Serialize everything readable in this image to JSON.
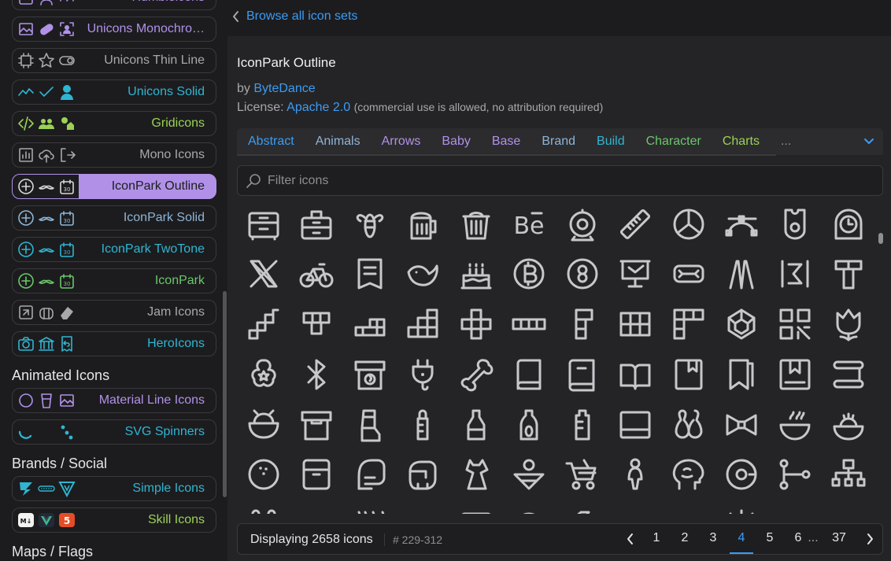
{
  "sidebar": {
    "sets": [
      {
        "label": "Humbleicons",
        "color": "#b191e8",
        "icons": [
          "archive-icon",
          "user-icon",
          "gauge-icon"
        ]
      },
      {
        "label": "Unicons Monochro…",
        "color": "#b191e8",
        "icons": [
          "image-icon",
          "pill-icon",
          "user-frame-icon"
        ]
      },
      {
        "label": "Unicons Thin Line",
        "color": "#a8a8ac",
        "icons": [
          "chip-icon",
          "star-icon",
          "toggle-icon"
        ]
      },
      {
        "label": "Unicons Solid",
        "color": "#2fb5d2",
        "icons": [
          "chart-line-icon",
          "check-icon",
          "user-solid-icon"
        ]
      },
      {
        "label": "Gridicons",
        "color": "#9bd156",
        "icons": [
          "code-icon",
          "users-icon",
          "shapes-icon"
        ]
      },
      {
        "label": "Mono Icons",
        "color": "#a8a8ac",
        "icons": [
          "bar-chart-icon",
          "cloud-upload-icon",
          "log-out-icon"
        ]
      },
      {
        "label": "IconPark Outline",
        "color": "#1c1c1e",
        "icons": [
          "add-circle-icon",
          "mustache-icon",
          "calendar-30-icon"
        ],
        "active": true
      },
      {
        "label": "IconPark Solid",
        "color": "#8fb4d6",
        "icons": [
          "add-circle-icon",
          "mustache-icon",
          "calendar-30-icon"
        ]
      },
      {
        "label": "IconPark TwoTone",
        "color": "#2fb5d2",
        "icons": [
          "add-circle-icon",
          "mustache-icon",
          "calendar-30-icon"
        ]
      },
      {
        "label": "IconPark",
        "color": "#6bc76b",
        "icons": [
          "add-circle-icon",
          "mustache-icon",
          "calendar-30-icon"
        ]
      },
      {
        "label": "Jam Icons",
        "color": "#a8a8ac",
        "icons": [
          "resize-icon",
          "luggage-icon",
          "eraser-icon"
        ]
      },
      {
        "label": "HeroIcons",
        "color": "#2fb5d2",
        "icons": [
          "camera-icon",
          "bank-icon",
          "receipt-refund-icon"
        ]
      }
    ],
    "groups": {
      "animated": "Animated Icons",
      "brands": "Brands / Social",
      "maps": "Maps / Flags"
    },
    "animated_sets": [
      {
        "label": "Material Line Icons",
        "color": "#b191e8",
        "icons": [
          "loading-circle-icon",
          "cup-icon",
          "image-icon"
        ]
      },
      {
        "label": "SVG Spinners",
        "color": "#2fb5d2",
        "icons": [
          "spinner-arc-icon",
          "spinner-blank-icon",
          "spinner-dots-icon"
        ]
      }
    ],
    "brand_sets": [
      {
        "label": "Simple Icons",
        "color": "#2fb5d2",
        "icons": [
          "brand-z-icon",
          "brand-bar-icon",
          "brand-v-icon"
        ]
      },
      {
        "label": "Skill Icons",
        "color": "#9bd156",
        "icons": [
          "markdown-icon",
          "vue-icon",
          "html5-icon"
        ]
      }
    ]
  },
  "main": {
    "back_link": "Browse all icon sets",
    "title": "IconPark Outline",
    "by_prefix": "by",
    "author": "ByteDance",
    "license_prefix": "License:",
    "license": "Apache 2.0",
    "license_note": "(commercial use is allowed, no attribution required)",
    "categories": [
      {
        "label": "Abstract",
        "color": "#3b9cf5"
      },
      {
        "label": "Animals",
        "color": "#8fb4d6"
      },
      {
        "label": "Arrows",
        "color": "#b191e8"
      },
      {
        "label": "Baby",
        "color": "#b191e8"
      },
      {
        "label": "Base",
        "color": "#b191e8"
      },
      {
        "label": "Brand",
        "color": "#8fb4d6"
      },
      {
        "label": "Build",
        "color": "#2fb5d2"
      },
      {
        "label": "Character",
        "color": "#6bc76b"
      },
      {
        "label": "Charts",
        "color": "#9bd156"
      }
    ],
    "categories_more": "...",
    "filter_placeholder": "Filter icons",
    "footer": {
      "displaying": "Displaying 2658 icons",
      "range": "# 229-312",
      "pages": [
        "1",
        "2",
        "3",
        "4",
        "5",
        "6",
        "...",
        "37"
      ],
      "active_page": "4"
    }
  }
}
